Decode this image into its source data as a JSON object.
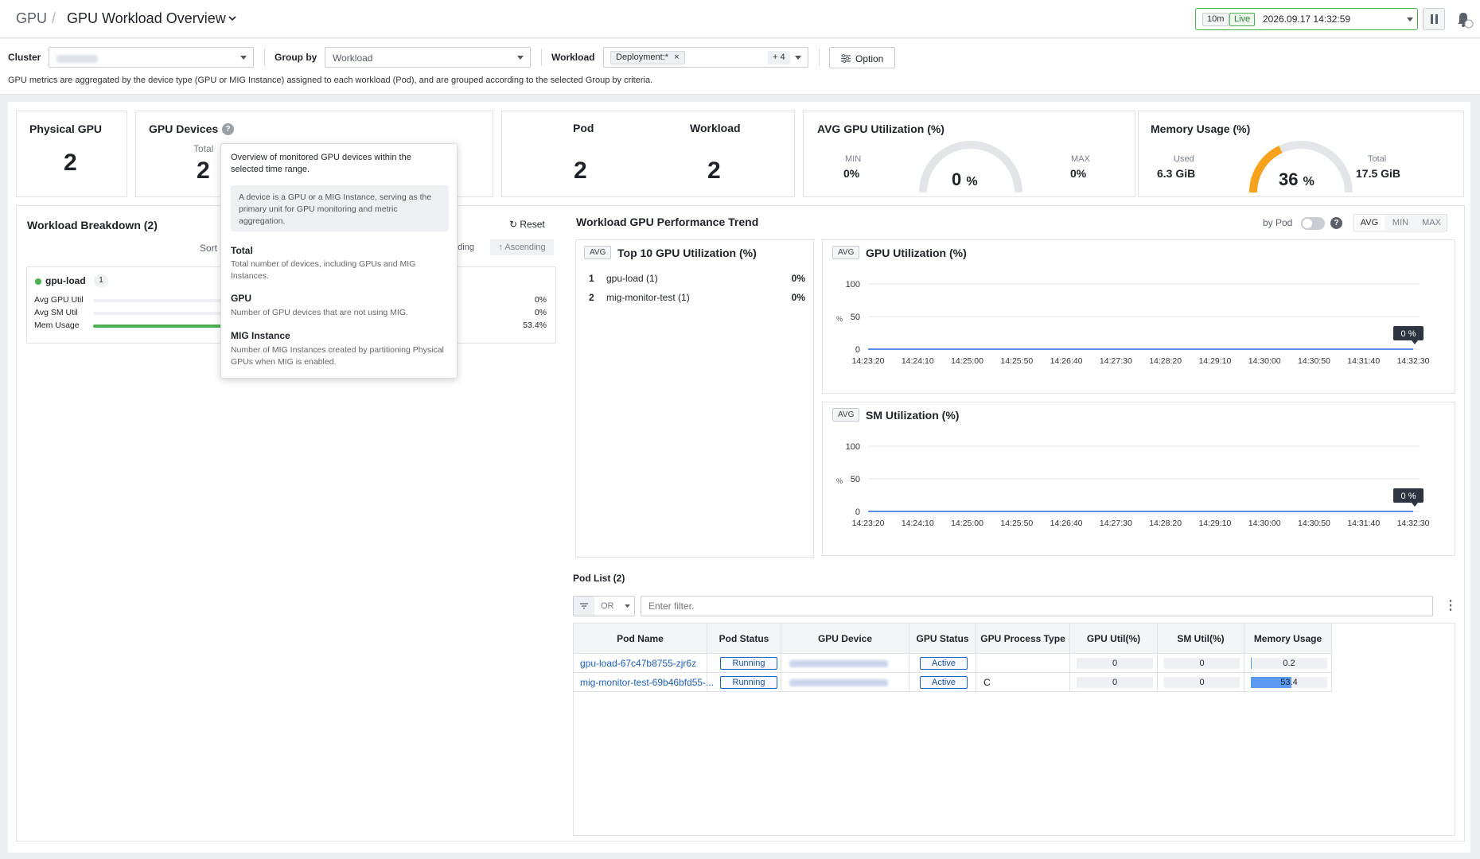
{
  "header": {
    "breadcrumb_root": "GPU",
    "breadcrumb_sep": "/",
    "title": "GPU Workload Overview",
    "time_range": "10m",
    "live_label": "Live",
    "timestamp": "2026.09.17 14:32:59"
  },
  "filters": {
    "cluster_label": "Cluster",
    "group_by_label": "Group by",
    "group_by_value": "Workload",
    "workload_label": "Workload",
    "workload_chip": "Deployment:*",
    "workload_more": "+ 4",
    "option_label": "Option",
    "description": "GPU metrics are aggregated by the device type (GPU or MIG Instance) assigned to each workload (Pod), and are grouped according to the selected Group by criteria."
  },
  "summary": {
    "physical_gpu_label": "Physical GPU",
    "physical_gpu_value": "2",
    "gpu_devices_label": "GPU Devices",
    "gpu_devices_total_label": "Total",
    "gpu_devices_total_value": "2",
    "pod_label": "Pod",
    "pod_value": "2",
    "workload_label": "Workload",
    "workload_value": "2",
    "avg_util_label": "AVG GPU Utilization (%)",
    "avg_min_label": "MIN",
    "avg_min_value": "0%",
    "avg_max_label": "MAX",
    "avg_max_value": "0%",
    "avg_gauge_value": "0",
    "avg_gauge_unit": "%",
    "avg_gauge_fraction": 0,
    "mem_label": "Memory Usage (%)",
    "mem_used_label": "Used",
    "mem_used_value": "6.3 GiB",
    "mem_total_label": "Total",
    "mem_total_value": "17.5 GiB",
    "mem_gauge_value": "36",
    "mem_gauge_unit": "%",
    "mem_gauge_fraction": 0.36
  },
  "tooltip": {
    "intro": "Overview of monitored GPU devices within the selected time range.",
    "note": "A device is a GPU or a MIG Instance, serving as the primary unit for GPU monitoring and metric aggregation.",
    "total_h": "Total",
    "total_d": "Total number of devices, including GPUs and MIG Instances.",
    "gpu_h": "GPU",
    "gpu_d": "Number of GPU devices that are not using MIG.",
    "mig_h": "MIG Instance",
    "mig_d": "Number of MIG Instances created by partitioning Physical GPUs when MIG is enabled."
  },
  "breakdown": {
    "title": "Workload Breakdown (2)",
    "reset_label": "Reset",
    "sort_label": "Sort",
    "descending_label": "ending",
    "ascending_label": "Ascending",
    "item_name": "gpu-load",
    "item_count": "1",
    "metrics": [
      {
        "label": "Avg GPU Util",
        "value": "0%",
        "fraction": 0
      },
      {
        "label": "Avg SM Util",
        "value": "0%",
        "fraction": 0
      },
      {
        "label": "Mem Usage",
        "value": "53.4%",
        "fraction": 0.534
      }
    ]
  },
  "trend": {
    "title": "Workload GPU Performance Trend",
    "by_pod_label": "by Pod",
    "agg_tabs": [
      "AVG",
      "MIN",
      "MAX"
    ],
    "top10_tag": "AVG",
    "top10_title": "Top 10 GPU Utilization (%)",
    "top10": [
      {
        "rank": "1",
        "name": "gpu-load (1)",
        "value": "0%"
      },
      {
        "rank": "2",
        "name": "mig-monitor-test (1)",
        "value": "0%"
      }
    ]
  },
  "chart_data": [
    {
      "type": "line",
      "tag": "AVG",
      "title": "GPU Utilization (%)",
      "ylabel": "%",
      "ylim": [
        0,
        100
      ],
      "yticks": [
        "100",
        "50",
        "0"
      ],
      "x": [
        "14:23:20",
        "14:24:10",
        "14:25:00",
        "14:25:50",
        "14:26:40",
        "14:27:30",
        "14:28:20",
        "14:29:10",
        "14:30:00",
        "14:30:50",
        "14:31:40",
        "14:32:30"
      ],
      "series": [
        {
          "values": [
            0,
            0,
            0,
            0,
            0,
            0,
            0,
            0,
            0,
            0,
            0,
            0
          ]
        }
      ],
      "last_label": "0 %",
      "color": "#5b8def"
    },
    {
      "type": "line",
      "tag": "AVG",
      "title": "SM Utilization (%)",
      "ylabel": "%",
      "ylim": [
        0,
        100
      ],
      "yticks": [
        "100",
        "50",
        "0"
      ],
      "x": [
        "14:23:20",
        "14:24:10",
        "14:25:00",
        "14:25:50",
        "14:26:40",
        "14:27:30",
        "14:28:20",
        "14:29:10",
        "14:30:00",
        "14:30:50",
        "14:31:40",
        "14:32:30"
      ],
      "series": [
        {
          "values": [
            0,
            0,
            0,
            0,
            0,
            0,
            0,
            0,
            0,
            0,
            0,
            0
          ]
        }
      ],
      "last_label": "0 %",
      "color": "#5b8def"
    }
  ],
  "pod_list": {
    "title": "Pod List (2)",
    "filter_op": "OR",
    "filter_placeholder": "Enter filter.",
    "columns": [
      "Pod Name",
      "Pod Status",
      "GPU Device",
      "GPU Status",
      "GPU Process Type",
      "GPU Util(%)",
      "SM Util(%)",
      "Memory Usage"
    ],
    "rows": [
      {
        "pod_name": "gpu-load-67c47b8755-zjr6z",
        "pod_status": "Running",
        "gpu_status": "Active",
        "process_type": "",
        "gpu_util": "0",
        "sm_util": "0",
        "mem_usage": "0.2",
        "mem_fraction": 0.002
      },
      {
        "pod_name": "mig-monitor-test-69b46bfd55-...",
        "pod_status": "Running",
        "gpu_status": "Active",
        "process_type": "C",
        "gpu_util": "0",
        "sm_util": "0",
        "mem_usage": "53.4",
        "mem_fraction": 0.534
      }
    ]
  },
  "colors": {
    "accent": "#1f5fbf",
    "live_green": "#4caf50",
    "gauge_orange": "#f7a21b",
    "gauge_track": "#e3e5e8"
  }
}
